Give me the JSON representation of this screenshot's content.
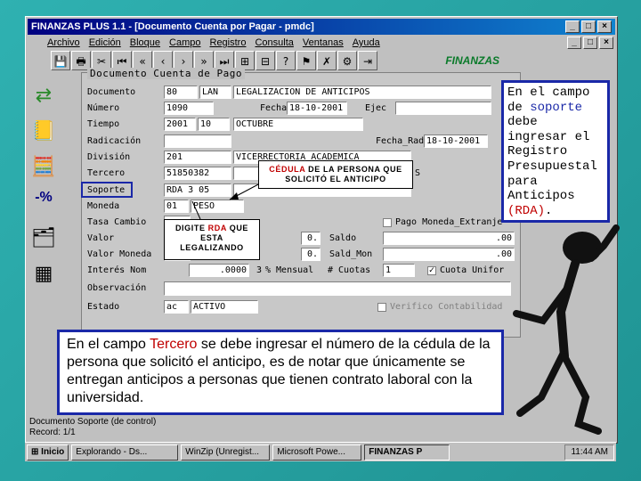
{
  "window": {
    "title": "FINANZAS PLUS 1.1 - [Documento Cuenta por Pagar - pmdc]",
    "controls": [
      "_",
      "□",
      "×"
    ],
    "mdi_controls": [
      "_",
      "□",
      "×"
    ]
  },
  "menu": [
    "Archivo",
    "Edición",
    "Bloque",
    "Campo",
    "Registro",
    "Consulta",
    "Ventanas",
    "Ayuda"
  ],
  "toolbar_icons": [
    "save-icon",
    "print-icon",
    "cut-icon",
    "first-record-icon",
    "prev-page-icon",
    "prev-record-icon",
    "next-record-icon",
    "next-page-icon",
    "last-record-icon",
    "insert-icon",
    "delete-icon",
    "query-icon",
    "execute-icon",
    "cancel-icon",
    "help-icon",
    "exit-icon"
  ],
  "logo": "FINANZAS",
  "sidebar_icons": [
    "arrows-icon",
    "notebook-icon",
    "calculator-icon",
    "percent-icon",
    "cards-icon",
    "table-icon"
  ],
  "sidebar_percent": "-%",
  "form": {
    "title": "Documento Cuenta de Pago",
    "labels": {
      "documento": "Documento",
      "numero": "Número",
      "tiempo": "Tiempo",
      "radicacion": "Radicación",
      "division": "División",
      "tercero": "Tercero",
      "soporte": "Soporte",
      "moneda": "Moneda",
      "tasa_cambio": "Tasa Cambio",
      "valor": "Valor",
      "valor_moneda": "Valor Moneda",
      "interes_nom": "Interés Nom",
      "observacion": "Observación",
      "estado": "Estado",
      "fecha": "Fecha",
      "ejec": "Ejec",
      "fecha_radic": "Fecha_Radic",
      "saldo": "Saldo",
      "sald_mon": "Sald_Mon",
      "mensual": "% Mensual",
      "num_cuotas": "# Cuotas"
    },
    "values": {
      "doc_code": "80",
      "doc_type": "LAN",
      "doc_desc": "LEGALIZACION DE ANTICIPOS",
      "numero": "1090",
      "fecha": "18-10-2001",
      "tiempo_year": "2001",
      "tiempo_month": "10",
      "tiempo_name": "OCTUBRE",
      "fecha_radic": "18-10-2001",
      "division_code": "201",
      "division_name": "VICERRECTORIA ACADEMICA",
      "tercero": "51850382",
      "tercero_tail": "S",
      "soporte": "RDA 3 05",
      "moneda_code": "01",
      "moneda_name": "PESO",
      "valor_tail": "0.",
      "valor_moneda_tail": "0.",
      "saldo": ".00",
      "sald_mon": ".00",
      "interes": ".0000",
      "mensual_num": "3",
      "cuotas": "1",
      "estado_code": "ac",
      "estado_name": "ACTIVO"
    },
    "checkboxes": {
      "pago_moneda": "Pago Moneda_Extranje",
      "cuota_unifor": "Cuota Unifor",
      "verifico": "Verifico Contabilidad"
    }
  },
  "callouts": {
    "tercero_pre": "CÉDULA",
    "tercero_post": " DE LA PERSONA QUE SOLICITÓ EL ANTICIPO",
    "soporte_pre": "DIGITE ",
    "soporte_red": "RDA",
    "soporte_post": " QUE ESTA LEGALIZANDO"
  },
  "note_right": {
    "t1": "En el campo de ",
    "t2": "soporte",
    "t3": " debe ingresar el Registro Presupuestal para Anticipos ",
    "t4": "(RDA)",
    "t5": "."
  },
  "note_bottom": {
    "t1": "En el campo ",
    "t2": "Tercero",
    "t3": " se debe ingresar el número de la cédula de la persona que solicitó el anticipo, es de notar que únicamente se entregan anticipos a personas que tienen contrato laboral con la universidad."
  },
  "status": {
    "line1": "Documento Soporte (de control)",
    "line2": "Record: 1/1"
  },
  "taskbar": {
    "start": "Inicio",
    "tasks": [
      "Explorando - Ds...",
      "WinZip (Unregist...",
      "Microsoft Powe...",
      "FINANZAS P"
    ],
    "clock": "11:44 AM"
  }
}
